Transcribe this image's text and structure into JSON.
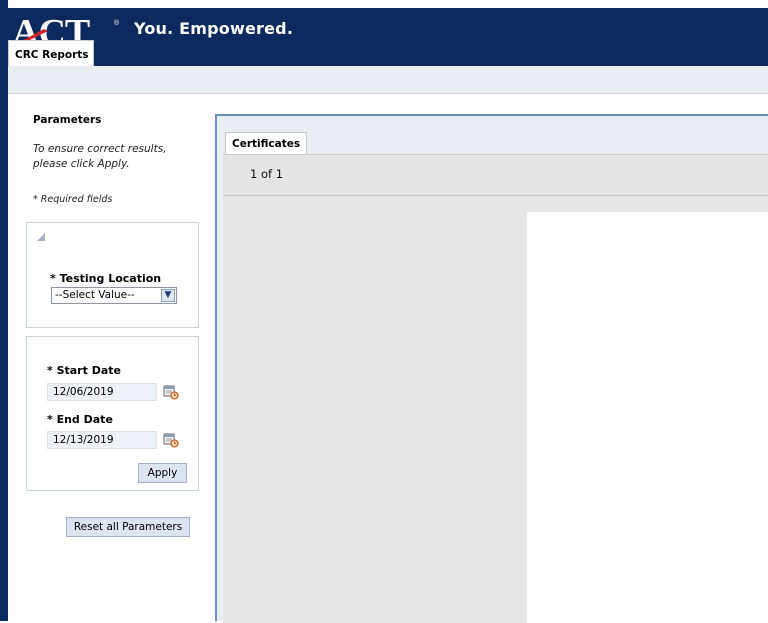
{
  "header": {
    "logo_text": "ACT",
    "tagline": "You. Empowered.",
    "tab_label": "CRC Reports"
  },
  "parameters": {
    "title": "Parameters",
    "note": "To ensure correct results, please click Apply.",
    "required_note": "* Required fields",
    "testing_location": {
      "label": "* Testing Location",
      "value": "--Select Value--"
    },
    "start_date": {
      "label": "* Start Date",
      "value": "12/06/2019"
    },
    "end_date": {
      "label": "* End Date",
      "value": "12/13/2019"
    },
    "apply_label": "Apply",
    "reset_label": "Reset all Parameters"
  },
  "report": {
    "tab_label": "Certificates",
    "page_counter": "1 of 1"
  },
  "colors": {
    "brand_navy": "#0c2a5e",
    "frame_border": "#6f8fc0",
    "button_fill": "#dbe4ef"
  },
  "icons": [
    "collapse-triangle-icon",
    "chevron-down-icon",
    "calendar-icon"
  ]
}
